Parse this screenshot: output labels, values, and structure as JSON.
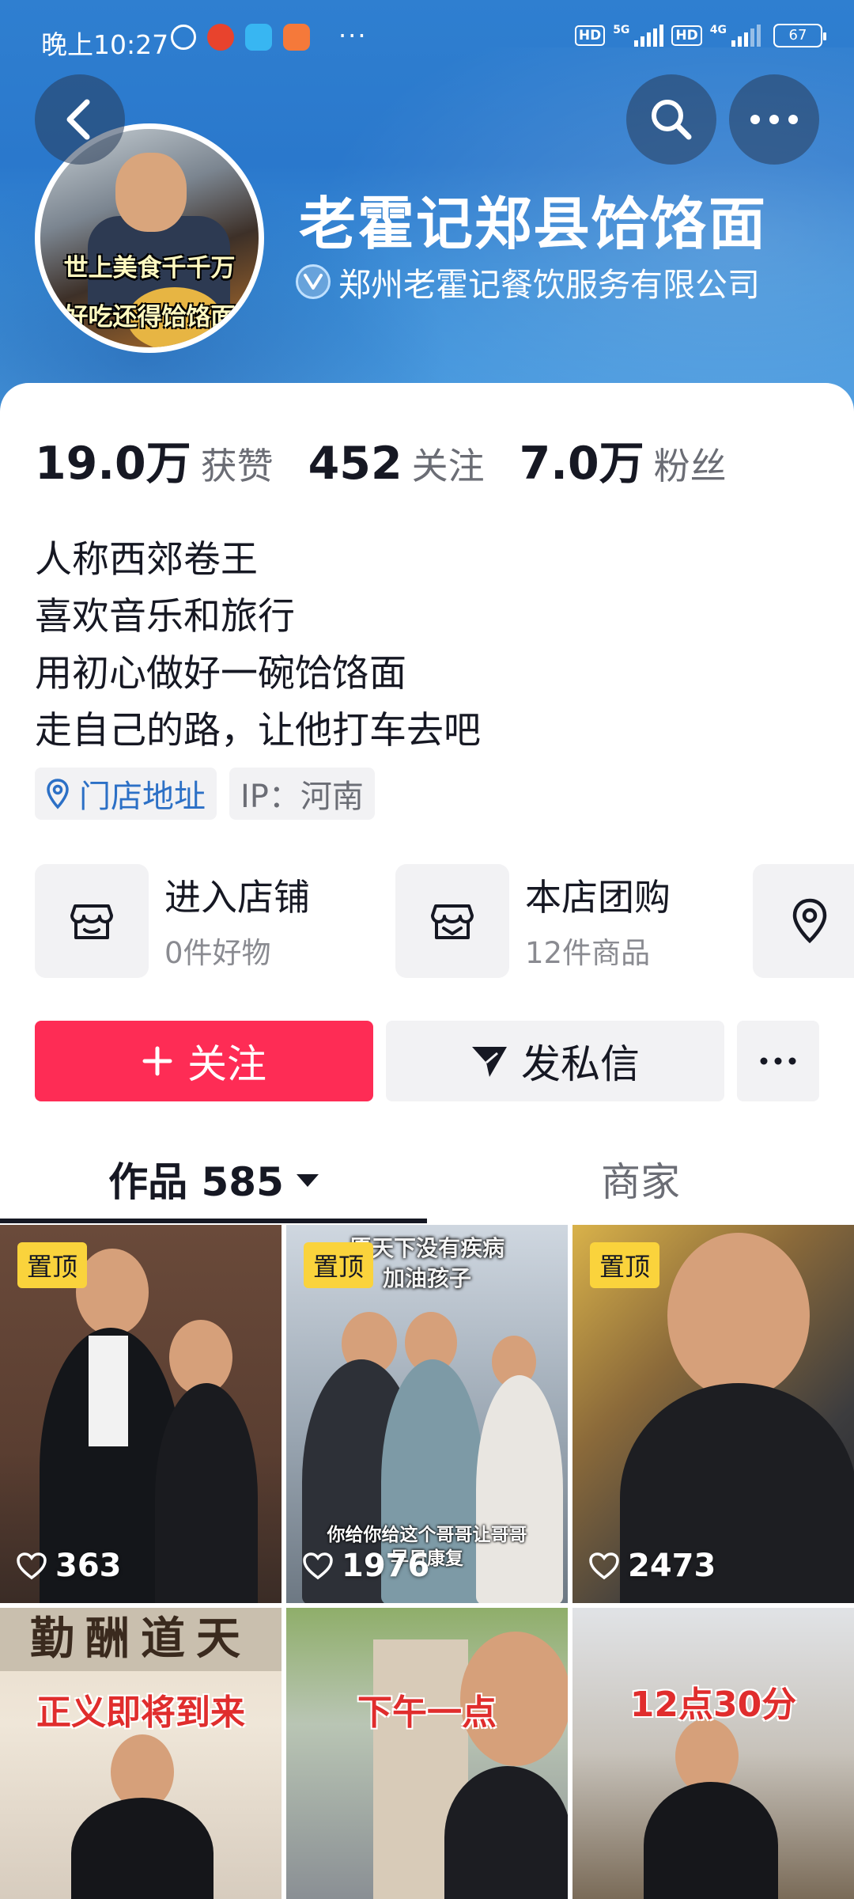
{
  "status_bar": {
    "time": "晚上10:27",
    "dots": "···",
    "hd1": "HD",
    "net1": "5G",
    "hd2": "HD",
    "net2": "4G",
    "battery": "67"
  },
  "profile": {
    "name": "老霍记郑县饸饹面",
    "verified_org": "郑州老霍记餐饮服务有限公司",
    "avatar_caption_top": "世上美食千千万",
    "avatar_caption_bottom": "好吃还得饸饹面"
  },
  "stats": [
    {
      "value": "19.0万",
      "label": "获赞"
    },
    {
      "value": "452",
      "label": "关注"
    },
    {
      "value": "7.0万",
      "label": "粉丝"
    }
  ],
  "bio": [
    "人称西郊卷王",
    "喜欢音乐和旅行",
    "用初心做好一碗饸饹面",
    "走自己的路，让他打车去吧"
  ],
  "tags": {
    "location_label": "门店地址",
    "ip_label": "IP：河南"
  },
  "shop_entries": [
    {
      "title": "进入店铺",
      "subtitle": "0件好物",
      "icon": "store-icon"
    },
    {
      "title": "本店团购",
      "subtitle": "12件商品",
      "icon": "shop-basket-icon"
    },
    {
      "title": "",
      "subtitle": "",
      "icon": "map-pin-icon"
    }
  ],
  "actions": {
    "follow_label": "关注",
    "message_label": "发私信",
    "more_label": "···"
  },
  "tabs": {
    "works_label": "作品 585",
    "merchant_label": "商家"
  },
  "videos": [
    {
      "pinned_label": "置顶",
      "likes": "363",
      "overlay": ""
    },
    {
      "pinned_label": "置顶",
      "likes": "1976",
      "overlay": "愿天下没有疾病",
      "overlay2": "加油孩子",
      "caption1": "你给你给这个哥哥让哥哥",
      "caption2": "早日康复"
    },
    {
      "pinned_label": "置顶",
      "likes": "2473",
      "overlay": ""
    },
    {
      "pinned_label": "",
      "likes": "",
      "overlay": "正义即将到来",
      "top_sign": "勤酬道天"
    },
    {
      "pinned_label": "",
      "likes": "",
      "overlay": "下午一点"
    },
    {
      "pinned_label": "",
      "likes": "",
      "overlay": "12点30分"
    }
  ],
  "colors": {
    "accent": "#fe2c55",
    "banner": "#2f7fd0",
    "pin": "#fad33c",
    "link": "#2c70c6"
  }
}
